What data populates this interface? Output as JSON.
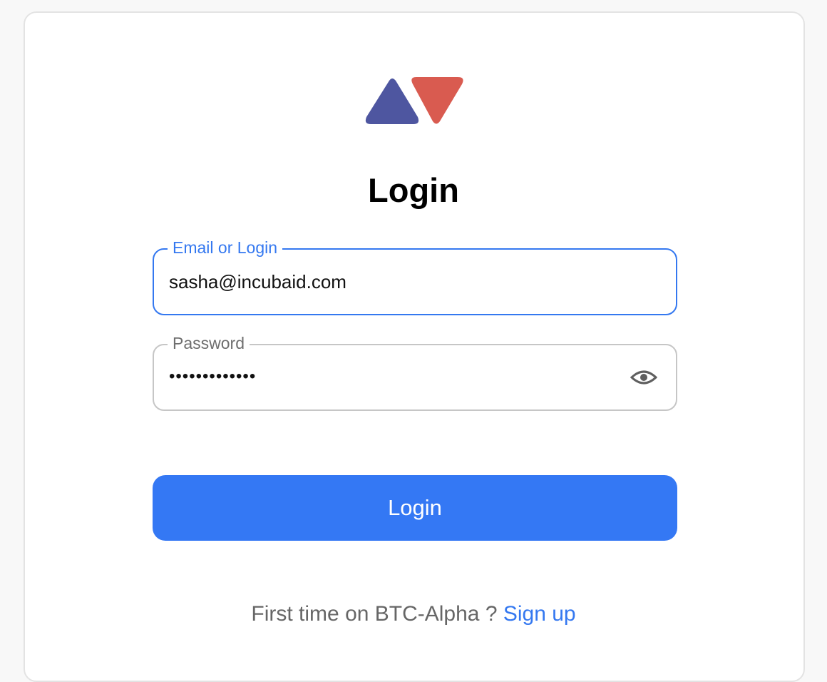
{
  "brand": {
    "logo_icon": "btc-alpha-logo-icon",
    "left_triangle_color": "#4e56a0",
    "right_triangle_color": "#d95b50"
  },
  "page": {
    "title": "Login"
  },
  "form": {
    "email": {
      "label": "Email or Login",
      "value": "sasha@incubaid.com"
    },
    "password": {
      "label": "Password",
      "masked_value": "•••••••••••••",
      "toggle_icon": "eye-icon"
    },
    "submit_label": "Login"
  },
  "footer": {
    "prompt": "First time on BTC-Alpha ? ",
    "signup_link": "Sign up"
  },
  "colors": {
    "accent": "#3478f4",
    "background": "#f8f8f8",
    "card": "#ffffff"
  }
}
